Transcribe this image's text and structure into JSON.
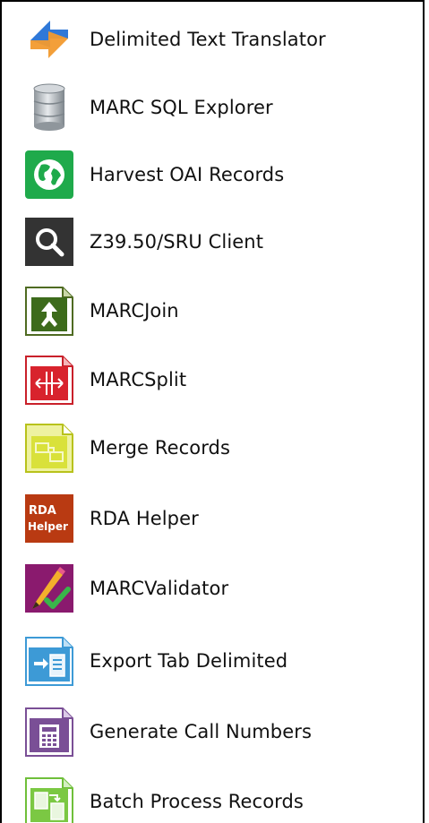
{
  "menu": {
    "items": [
      {
        "label": "Delimited Text Translator",
        "icon": "delimited-text-translator-icon"
      },
      {
        "label": "MARC SQL Explorer",
        "icon": "database-icon"
      },
      {
        "label": "Harvest OAI Records",
        "icon": "globe-icon"
      },
      {
        "label": "Z39.50/SRU Client",
        "icon": "magnifier-icon"
      },
      {
        "label": "MARCJoin",
        "icon": "marcjoin-icon"
      },
      {
        "label": "MARCSplit",
        "icon": "marcsplit-icon"
      },
      {
        "label": "Merge Records",
        "icon": "merge-records-icon"
      },
      {
        "label": "RDA Helper",
        "icon": "rda-helper-icon",
        "icon_text_line1": "RDA",
        "icon_text_line2": "Helper"
      },
      {
        "label": "MARCValidator",
        "icon": "marcvalidator-icon"
      },
      {
        "label": "Export Tab Delimited",
        "icon": "export-tab-delimited-icon"
      },
      {
        "label": "Generate Call Numbers",
        "icon": "generate-call-numbers-icon"
      },
      {
        "label": "Batch Process Records",
        "icon": "batch-process-records-icon"
      }
    ]
  }
}
